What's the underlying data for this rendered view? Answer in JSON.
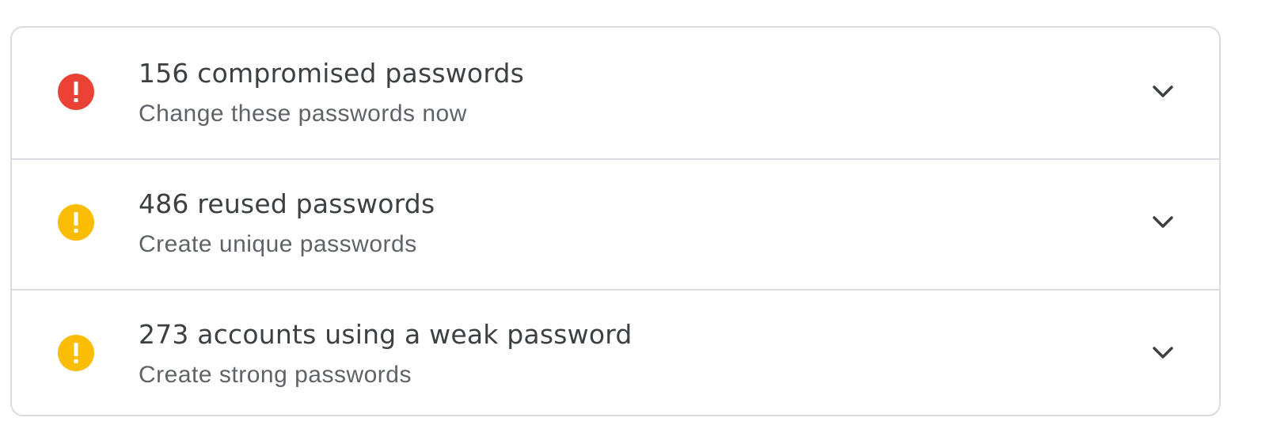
{
  "issues": [
    {
      "title": "156 compromised passwords",
      "subtitle": "Change these passwords now",
      "severity": "critical",
      "icon": "error-icon",
      "icon_color": "#ea4335"
    },
    {
      "title": "486 reused passwords",
      "subtitle": "Create unique passwords",
      "severity": "warning",
      "icon": "warning-icon",
      "icon_color": "#fbbc04"
    },
    {
      "title": "273 accounts using a weak password",
      "subtitle": "Create strong passwords",
      "severity": "warning",
      "icon": "warning-icon",
      "icon_color": "#fbbc04"
    }
  ],
  "expand_icon": "chevron-down-icon",
  "colors": {
    "border": "#dadce0",
    "title_text": "#3c4043",
    "subtitle_text": "#5f6368",
    "chevron": "#3c4043"
  }
}
